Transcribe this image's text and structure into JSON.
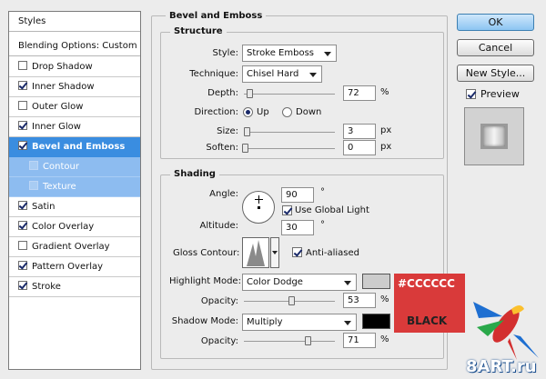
{
  "styles_panel": {
    "header": "Styles",
    "blending": "Blending Options: Custom",
    "items": [
      {
        "label": "Drop Shadow",
        "checked": false
      },
      {
        "label": "Inner Shadow",
        "checked": true
      },
      {
        "label": "Outer Glow",
        "checked": false
      },
      {
        "label": "Inner Glow",
        "checked": true
      },
      {
        "label": "Bevel and Emboss",
        "checked": true
      },
      {
        "label": "Contour",
        "checked": false
      },
      {
        "label": "Texture",
        "checked": false
      },
      {
        "label": "Satin",
        "checked": true
      },
      {
        "label": "Color Overlay",
        "checked": true
      },
      {
        "label": "Gradient Overlay",
        "checked": false
      },
      {
        "label": "Pattern Overlay",
        "checked": true
      },
      {
        "label": "Stroke",
        "checked": true
      }
    ]
  },
  "bevel": {
    "title": "Bevel and Emboss",
    "structure": {
      "title": "Structure",
      "style_label": "Style:",
      "style_value": "Stroke Emboss",
      "technique_label": "Technique:",
      "technique_value": "Chisel Hard",
      "depth_label": "Depth:",
      "depth_value": "72",
      "depth_unit": "%",
      "depth_level": 0.72,
      "direction_label": "Direction:",
      "up_label": "Up",
      "down_label": "Down",
      "direction": "Up",
      "size_label": "Size:",
      "size_value": "3",
      "size_unit": "px",
      "size_level": 0.03,
      "soften_label": "Soften:",
      "soften_value": "0",
      "soften_unit": "px",
      "soften_level": 0.0
    },
    "shading": {
      "title": "Shading",
      "angle_label": "Angle:",
      "angle_value": "90",
      "angle_unit": "°",
      "global_light_label": "Use Global Light",
      "global_light": true,
      "altitude_label": "Altitude:",
      "altitude_value": "30",
      "altitude_unit": "°",
      "gloss_label": "Gloss Contour:",
      "antialias_label": "Anti-aliased",
      "antialias": true,
      "highlight_label": "Highlight Mode:",
      "highlight_value": "Color Dodge",
      "highlight_color": "#cccccc",
      "hl_opacity_label": "Opacity:",
      "hl_opacity_value": "53",
      "hl_opacity_unit": "%",
      "hl_opacity_level": 0.53,
      "shadow_label": "Shadow Mode:",
      "shadow_value": "Multiply",
      "shadow_color": "#000000",
      "sh_opacity_label": "Opacity:",
      "sh_opacity_value": "71",
      "sh_opacity_unit": "%",
      "sh_opacity_level": 0.71
    }
  },
  "buttons": {
    "ok": "OK",
    "cancel": "Cancel",
    "new_style": "New Style...",
    "preview_label": "Preview",
    "preview": true
  },
  "annotation": {
    "color_code": "#CCCCCC",
    "color_name": "BLACK",
    "bg": "#d93a3a"
  },
  "watermark": "8ART.ru"
}
